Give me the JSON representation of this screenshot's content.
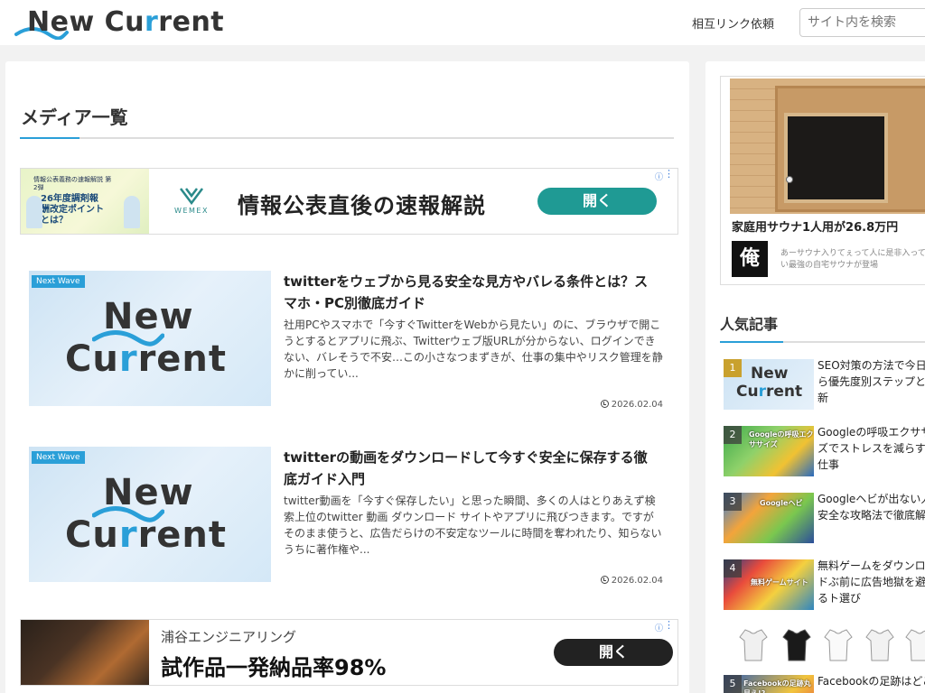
{
  "header": {
    "logo_text_pre": "New Cu",
    "logo_text_accent": "r",
    "logo_text_post": "rent",
    "nav_link": "相互リンク依頼",
    "search_placeholder": "サイト内を検索"
  },
  "main": {
    "page_title": "メディア一覧",
    "ad_top": {
      "thumb_small": "情報公表義務の速報解説 第2弾",
      "thumb_big": "26年度調剤報酬改定ポイントとは？",
      "brand": "WEMEX",
      "headline": "情報公表直後の速報解説",
      "cta": "開く",
      "info_icon": "info-icon",
      "menu_icon": "kebab-menu-icon"
    },
    "articles": [
      {
        "tag": "Next Wave",
        "thumb_line1": "New",
        "thumb_line2_pre": "Cu",
        "thumb_line2_accent": "r",
        "thumb_line2_post": "rent",
        "title": "twitterをウェブから見る安全な見方やバレる条件とは？スマホ・PC別徹底ガイド",
        "excerpt": "社用PCやスマホで「今すぐTwitterをWebから見たい」のに、ブラウザで開こうとするとアプリに飛ぶ、Twitterウェブ版URLが分からない、ログインできない、バレそうで不安…この小さなつまずきが、仕事の集中やリスク管理を静かに削ってい...",
        "date": "2026.02.04"
      },
      {
        "tag": "Next Wave",
        "thumb_line1": "New",
        "thumb_line2_pre": "Cu",
        "thumb_line2_accent": "r",
        "thumb_line2_post": "rent",
        "title": "twitterの動画をダウンロードして今すぐ安全に保存する徹底ガイド入門",
        "excerpt": "twitter動画を「今すぐ保存したい」と思った瞬間、多くの人はとりあえず検索上位のtwitter 動画 ダウンロード サイトやアプリに飛びつきます。ですがそのまま使うと、広告だらけの不安定なツールに時間を奪われたり、知らないうちに著作権や...",
        "date": "2026.02.04"
      }
    ],
    "ad_bottom": {
      "sponsor": "浦谷エンジニアリング",
      "headline": "試作品一発納品率98%",
      "cta": "開く"
    }
  },
  "sidebar": {
    "sauna_ad": {
      "title": "家庭用サウナ1人用が26.8万円",
      "logo_char": "俺",
      "desc": "あーサウナ入りてぇって人に是非入ってほしい最強の自宅サウナが登場"
    },
    "popular_heading": "人気記事",
    "popular": [
      {
        "rank": "1",
        "title": "SEO対策の方法で今日から優先度別ステップと最新",
        "thumb_text1": "New",
        "thumb_text2_pre": "Cu",
        "thumb_text2_accent": "r",
        "thumb_text2_post": "rent"
      },
      {
        "rank": "2",
        "title": "Googleの呼吸エクササイズでストレスを減らすIT仕事",
        "overlay": "Googleの呼吸エクササイズ"
      },
      {
        "rank": "3",
        "title": "Googleヘビが出ない人へ安全な攻略法で徹底解説",
        "overlay": "Googleヘビ"
      },
      {
        "rank": "4",
        "title": "無料ゲームをダウンロードぶ前に広告地獄を避けるト選び",
        "overlay": "無料ゲームサイト"
      },
      {
        "rank": "5",
        "title": "Facebookの足跡はどこ",
        "overlay": "Facebookの足跡丸見え!?"
      }
    ]
  },
  "colors": {
    "accent": "#2a9fd8",
    "ad_cta_teal": "#1f9a94",
    "ad_cta_dark": "#222222",
    "rank_gold": "#c9a12e"
  }
}
